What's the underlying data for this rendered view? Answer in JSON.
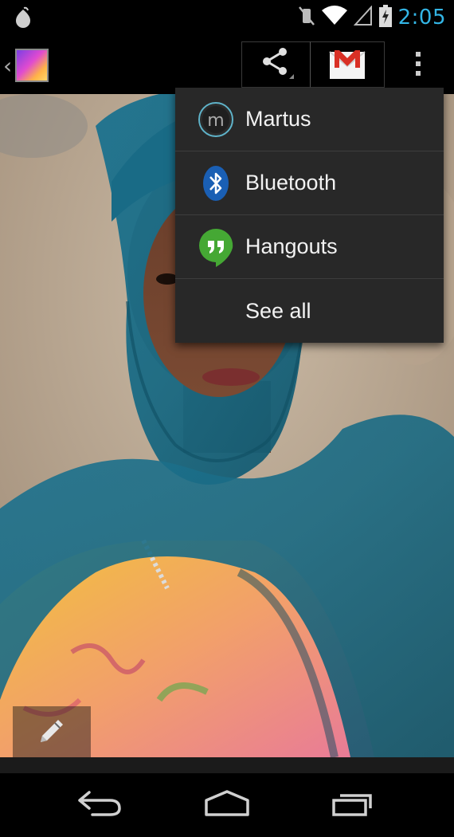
{
  "status_bar": {
    "time": "2:05",
    "icons": [
      "app-notification-icon",
      "vibrate-icon",
      "wifi-icon",
      "signal-icon",
      "battery-charging-icon"
    ],
    "clock_color": "#33b5e5"
  },
  "action_bar": {
    "app_icon": "gallery-app-icon",
    "share_icon": "share-icon",
    "gmail_icon": "gmail-icon",
    "overflow_icon": "overflow-menu-icon"
  },
  "share_menu": {
    "items": [
      {
        "label": "Martus",
        "icon": "martus-icon"
      },
      {
        "label": "Bluetooth",
        "icon": "bluetooth-icon"
      },
      {
        "label": "Hangouts",
        "icon": "hangouts-icon"
      },
      {
        "label": "See all",
        "icon": ""
      }
    ]
  },
  "edit": {
    "icon": "pencil-icon"
  },
  "nav_bar": {
    "buttons": [
      "back-icon",
      "home-icon",
      "recents-icon"
    ]
  },
  "colors": {
    "menu_background": "#282828",
    "accent_blue": "#33b5e5",
    "scarf_teal": "#1f6d84"
  }
}
